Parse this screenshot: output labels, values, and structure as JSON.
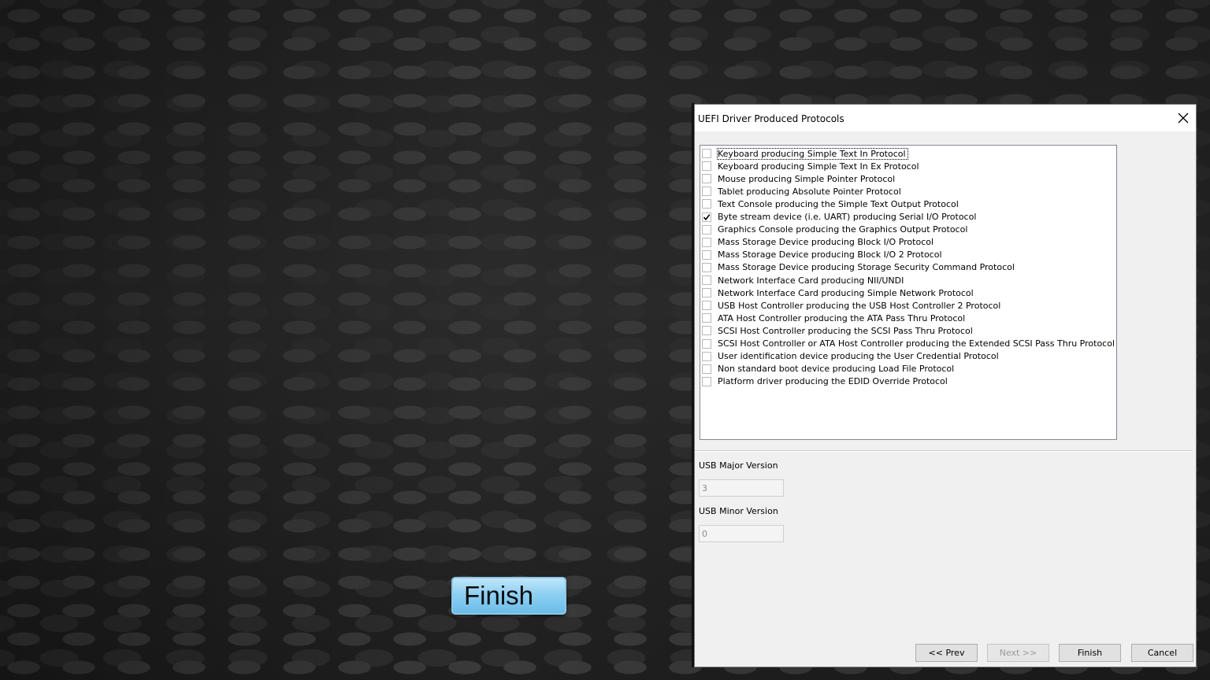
{
  "callout": {
    "label": "Finish"
  },
  "dialog": {
    "title": "UEFI Driver Produced Protocols",
    "close_icon": "close-icon",
    "protocols": [
      {
        "label": "Keyboard producing Simple Text In Protocol",
        "checked": false,
        "focused": true
      },
      {
        "label": "Keyboard producing Simple Text In Ex Protocol",
        "checked": false
      },
      {
        "label": "Mouse producing Simple Pointer Protocol",
        "checked": false
      },
      {
        "label": "Tablet producing Absolute Pointer Protocol",
        "checked": false
      },
      {
        "label": "Text Console producing the Simple Text Output Protocol",
        "checked": false
      },
      {
        "label": "Byte stream device (i.e. UART) producing Serial I/O Protocol",
        "checked": true
      },
      {
        "label": "Graphics Console producing the Graphics Output Protocol",
        "checked": false
      },
      {
        "label": "Mass Storage Device producing Block I/O Protocol",
        "checked": false
      },
      {
        "label": "Mass Storage Device producing Block I/O 2 Protocol",
        "checked": false
      },
      {
        "label": "Mass Storage Device producing Storage Security Command Protocol",
        "checked": false
      },
      {
        "label": "Network Interface Card producing NII/UNDI",
        "checked": false
      },
      {
        "label": "Network Interface Card producing Simple Network Protocol",
        "checked": false
      },
      {
        "label": "USB Host Controller producing the USB Host Controller 2 Protocol",
        "checked": false
      },
      {
        "label": "ATA Host Controller producing the ATA Pass Thru Protocol",
        "checked": false
      },
      {
        "label": "SCSI Host Controller producing the SCSI Pass Thru Protocol",
        "checked": false
      },
      {
        "label": "SCSI Host Controller or ATA Host Controller producing the Extended SCSI Pass Thru Protocol",
        "checked": false
      },
      {
        "label": "User identification device producing the User Credential Protocol",
        "checked": false
      },
      {
        "label": "Non standard boot device producing Load File Protocol",
        "checked": false
      },
      {
        "label": "Platform driver producing the EDID Override Protocol",
        "checked": false
      }
    ],
    "usb_major": {
      "label": "USB Major Version",
      "value": "3"
    },
    "usb_minor": {
      "label": "USB Minor Version",
      "value": "0"
    },
    "buttons": {
      "prev": "<< Prev",
      "next": "Next >>",
      "finish": "Finish",
      "cancel": "Cancel"
    }
  }
}
